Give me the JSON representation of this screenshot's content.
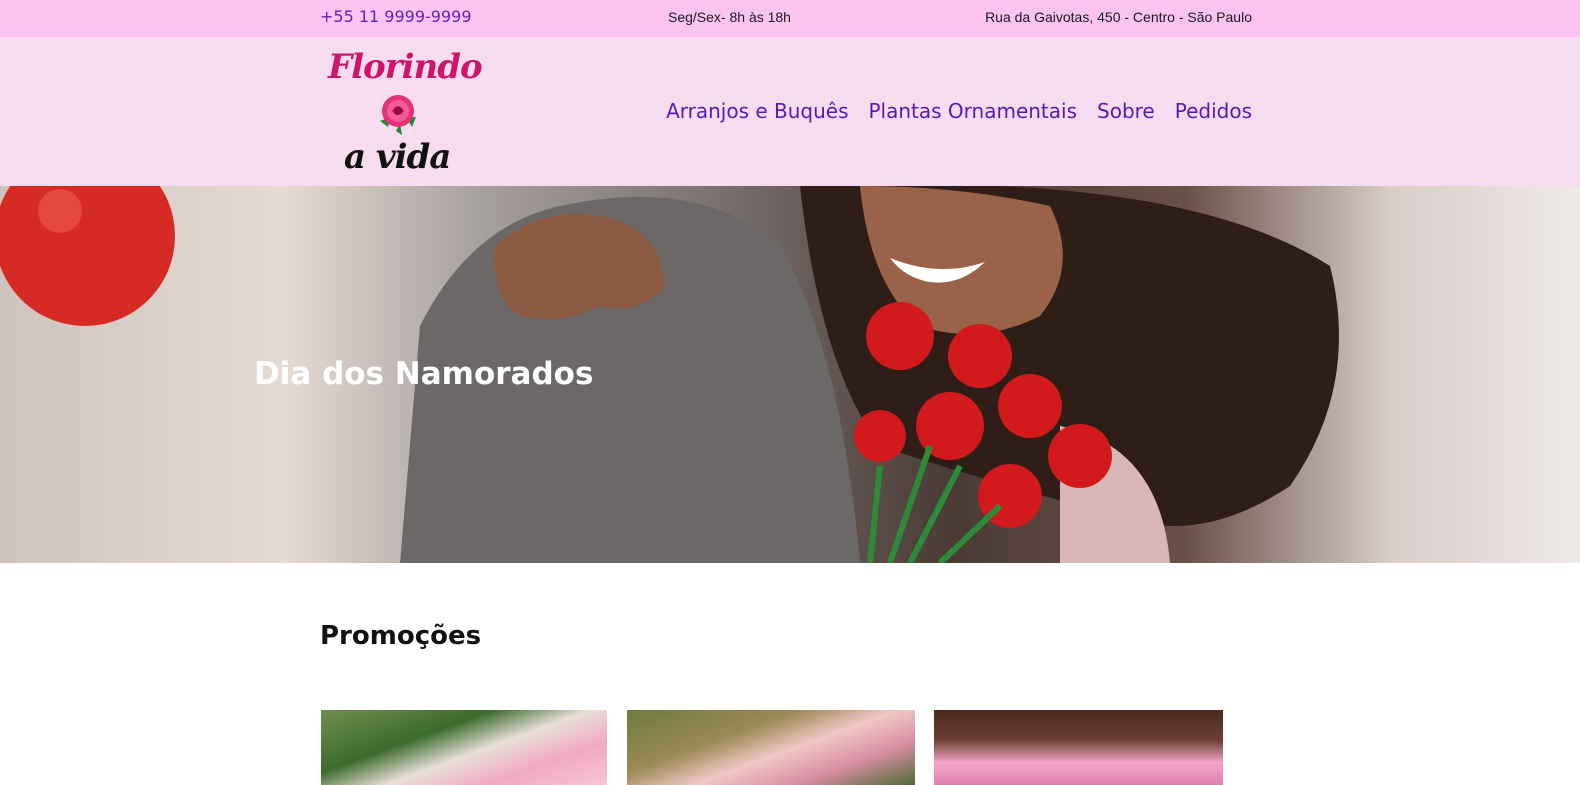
{
  "topbar": {
    "phone": "+55 11 9999-9999",
    "hours": "Seg/Sex- 8h às 18h",
    "address": "Rua da Gaivotas, 450 - Centro - São Paulo"
  },
  "header": {
    "logo": {
      "line1": "Florindo",
      "line2": "a vida",
      "icon": "rose-icon"
    },
    "nav": [
      {
        "label": "Arranjos e Buquês"
      },
      {
        "label": "Plantas Ornamentais"
      },
      {
        "label": "Sobre"
      },
      {
        "label": "Pedidos"
      }
    ]
  },
  "hero": {
    "title": "Dia dos Namorados"
  },
  "promo": {
    "title": "Promoções"
  },
  "colors": {
    "topbar_bg": "#fbc3f0",
    "header_bg": "#f6dcef",
    "nav_link": "#5d16b6",
    "logo_pink": "#d01469"
  }
}
